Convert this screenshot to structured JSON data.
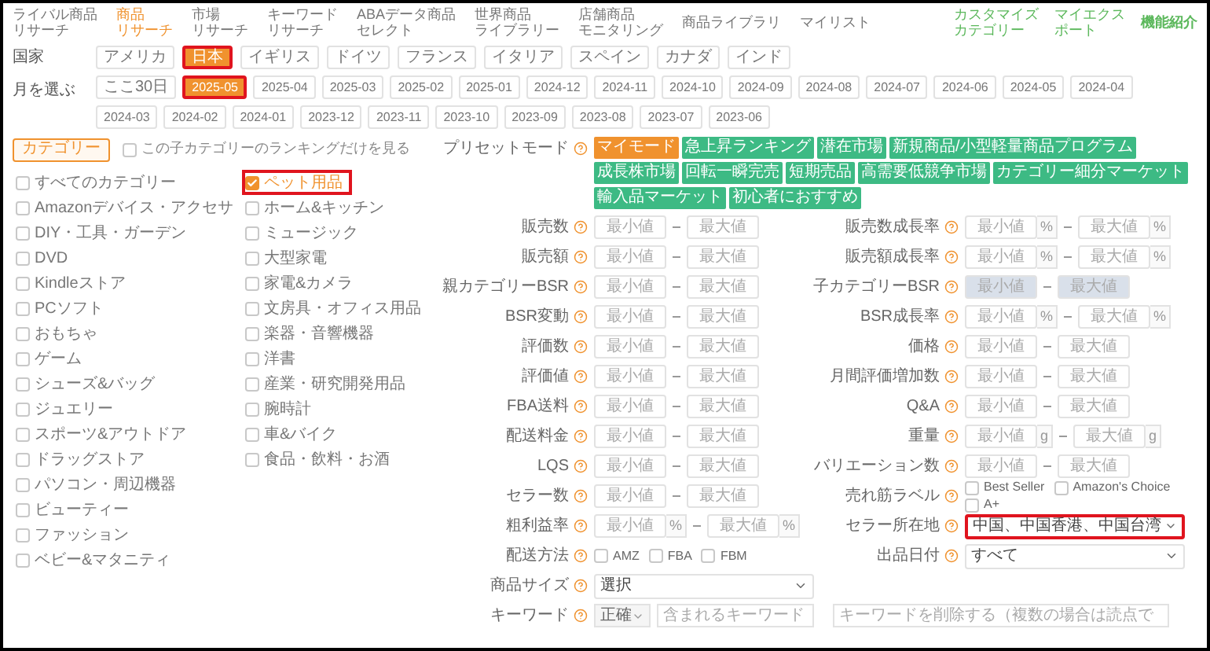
{
  "nav": {
    "items": [
      {
        "lines": [
          "ライバル商品",
          "リサーチ"
        ],
        "selected": false
      },
      {
        "lines": [
          "商品",
          "リサーチ"
        ],
        "selected": true
      },
      {
        "lines": [
          "市場",
          "リサーチ"
        ],
        "selected": false
      },
      {
        "lines": [
          "キーワード",
          "リサーチ"
        ],
        "selected": false
      },
      {
        "lines": [
          "ABAデータ商品",
          "セレクト"
        ],
        "selected": false
      },
      {
        "lines": [
          "世界商品",
          "ライブラリー"
        ],
        "selected": false
      },
      {
        "lines": [
          "店舗商品",
          "モニタリング"
        ],
        "selected": false
      },
      {
        "lines": [
          "商品ライブラリ"
        ],
        "selected": false
      },
      {
        "lines": [
          "マイリスト"
        ],
        "selected": false
      }
    ],
    "links": [
      {
        "lines": [
          "カスタマイズ",
          "カテゴリー"
        ],
        "kind": "link"
      },
      {
        "lines": [
          "マイエクス",
          "ポート"
        ],
        "kind": "link"
      },
      {
        "lines": [
          "機能紹介"
        ],
        "kind": "strong"
      }
    ]
  },
  "country": {
    "label": "国家",
    "options": [
      {
        "label": "アメリカ",
        "selected": false,
        "highlighted": false
      },
      {
        "label": "日本",
        "selected": true,
        "highlighted": true
      },
      {
        "label": "イギリス",
        "selected": false,
        "highlighted": false
      },
      {
        "label": "ドイツ",
        "selected": false,
        "highlighted": false
      },
      {
        "label": "フランス",
        "selected": false,
        "highlighted": false
      },
      {
        "label": "イタリア",
        "selected": false,
        "highlighted": false
      },
      {
        "label": "スペイン",
        "selected": false,
        "highlighted": false
      },
      {
        "label": "カナダ",
        "selected": false,
        "highlighted": false
      },
      {
        "label": "インド",
        "selected": false,
        "highlighted": false
      }
    ]
  },
  "month": {
    "label": "月を選ぶ",
    "options": [
      {
        "label": "ここ30日",
        "selected": false,
        "highlighted": false
      },
      {
        "label": "2025-05",
        "selected": true,
        "highlighted": true
      },
      {
        "label": "2025-04",
        "selected": false,
        "highlighted": false
      },
      {
        "label": "2025-03",
        "selected": false,
        "highlighted": false
      },
      {
        "label": "2025-02",
        "selected": false,
        "highlighted": false
      },
      {
        "label": "2025-01",
        "selected": false,
        "highlighted": false
      },
      {
        "label": "2024-12",
        "selected": false,
        "highlighted": false
      },
      {
        "label": "2024-11",
        "selected": false,
        "highlighted": false
      },
      {
        "label": "2024-10",
        "selected": false,
        "highlighted": false
      },
      {
        "label": "2024-09",
        "selected": false,
        "highlighted": false
      },
      {
        "label": "2024-08",
        "selected": false,
        "highlighted": false
      },
      {
        "label": "2024-07",
        "selected": false,
        "highlighted": false
      },
      {
        "label": "2024-06",
        "selected": false,
        "highlighted": false
      },
      {
        "label": "2024-05",
        "selected": false,
        "highlighted": false
      },
      {
        "label": "2024-04",
        "selected": false,
        "highlighted": false
      },
      {
        "label": "2024-03",
        "selected": false,
        "highlighted": false
      },
      {
        "label": "2024-02",
        "selected": false,
        "highlighted": false
      },
      {
        "label": "2024-01",
        "selected": false,
        "highlighted": false
      },
      {
        "label": "2023-12",
        "selected": false,
        "highlighted": false
      },
      {
        "label": "2023-11",
        "selected": false,
        "highlighted": false
      },
      {
        "label": "2023-10",
        "selected": false,
        "highlighted": false
      },
      {
        "label": "2023-09",
        "selected": false,
        "highlighted": false
      },
      {
        "label": "2023-08",
        "selected": false,
        "highlighted": false
      },
      {
        "label": "2023-07",
        "selected": false,
        "highlighted": false
      },
      {
        "label": "2023-06",
        "selected": false,
        "highlighted": false
      }
    ]
  },
  "category": {
    "button": "カテゴリー",
    "child_only": {
      "label": "この子カテゴリーのランキングだけを見る",
      "checked": false
    },
    "columns": [
      [
        {
          "label": "すべてのカテゴリー",
          "checked": false,
          "highlighted": false
        },
        {
          "label": "Amazonデバイス・アクセサ",
          "checked": false,
          "highlighted": false
        },
        {
          "label": "DIY・工具・ガーデン",
          "checked": false,
          "highlighted": false
        },
        {
          "label": "DVD",
          "checked": false,
          "highlighted": false
        },
        {
          "label": "Kindleストア",
          "checked": false,
          "highlighted": false
        },
        {
          "label": "PCソフト",
          "checked": false,
          "highlighted": false
        },
        {
          "label": "おもちゃ",
          "checked": false,
          "highlighted": false
        },
        {
          "label": "ゲーム",
          "checked": false,
          "highlighted": false
        },
        {
          "label": "シューズ&バッグ",
          "checked": false,
          "highlighted": false
        },
        {
          "label": "ジュエリー",
          "checked": false,
          "highlighted": false
        },
        {
          "label": "スポーツ&アウトドア",
          "checked": false,
          "highlighted": false
        },
        {
          "label": "ドラッグストア",
          "checked": false,
          "highlighted": false
        },
        {
          "label": "パソコン・周辺機器",
          "checked": false,
          "highlighted": false
        },
        {
          "label": "ビューティー",
          "checked": false,
          "highlighted": false
        },
        {
          "label": "ファッション",
          "checked": false,
          "highlighted": false
        },
        {
          "label": "ベビー&マタニティ",
          "checked": false,
          "highlighted": false
        }
      ],
      [
        {
          "label": "ペット用品",
          "checked": true,
          "highlighted": true
        },
        {
          "label": "ホーム&キッチン",
          "checked": false,
          "highlighted": false
        },
        {
          "label": "ミュージック",
          "checked": false,
          "highlighted": false
        },
        {
          "label": "大型家電",
          "checked": false,
          "highlighted": false
        },
        {
          "label": "家電&カメラ",
          "checked": false,
          "highlighted": false
        },
        {
          "label": "文房具・オフィス用品",
          "checked": false,
          "highlighted": false
        },
        {
          "label": "楽器・音響機器",
          "checked": false,
          "highlighted": false
        },
        {
          "label": "洋書",
          "checked": false,
          "highlighted": false
        },
        {
          "label": "産業・研究開発用品",
          "checked": false,
          "highlighted": false
        },
        {
          "label": "腕時計",
          "checked": false,
          "highlighted": false
        },
        {
          "label": "車&バイク",
          "checked": false,
          "highlighted": false
        },
        {
          "label": "食品・飲料・お酒",
          "checked": false,
          "highlighted": false
        }
      ]
    ]
  },
  "presets": {
    "label": "プリセットモード",
    "chips": [
      {
        "label": "マイモード",
        "selected": true
      },
      {
        "label": "急上昇ランキング",
        "selected": false
      },
      {
        "label": "潜在市場",
        "selected": false
      },
      {
        "label": "新規商品/小型軽量商品プログラム",
        "selected": false
      },
      {
        "label": "成長株市場",
        "selected": false
      },
      {
        "label": "回転一瞬完売",
        "selected": false
      },
      {
        "label": "短期売品",
        "selected": false
      },
      {
        "label": "高需要低競争市場",
        "selected": false
      },
      {
        "label": "カテゴリー細分マーケット",
        "selected": false
      },
      {
        "label": "輸入品マーケット",
        "selected": false
      },
      {
        "label": "初心者におすすめ",
        "selected": false
      }
    ]
  },
  "filter_rows": [
    [
      {
        "kind": "range",
        "label": "販売数",
        "min": {
          "placeholder": "最小値"
        },
        "max": {
          "placeholder": "最大値"
        },
        "disabled": false
      },
      {
        "kind": "range",
        "label": "販売数成長率",
        "min": {
          "placeholder": "最小値",
          "unit": "%"
        },
        "max": {
          "placeholder": "最大値",
          "unit": "%"
        },
        "disabled": false
      }
    ],
    [
      {
        "kind": "range",
        "label": "販売額",
        "min": {
          "placeholder": "最小値"
        },
        "max": {
          "placeholder": "最大値"
        },
        "disabled": false
      },
      {
        "kind": "range",
        "label": "販売額成長率",
        "min": {
          "placeholder": "最小値",
          "unit": "%"
        },
        "max": {
          "placeholder": "最大値",
          "unit": "%"
        },
        "disabled": false
      }
    ],
    [
      {
        "kind": "range",
        "label": "親カテゴリーBSR",
        "min": {
          "placeholder": "最小値"
        },
        "max": {
          "placeholder": "最大値"
        },
        "disabled": false
      },
      {
        "kind": "range",
        "label": "子カテゴリーBSR",
        "min": {
          "placeholder": "最小値"
        },
        "max": {
          "placeholder": "最大値"
        },
        "disabled": true
      }
    ],
    [
      {
        "kind": "range",
        "label": "BSR変動",
        "min": {
          "placeholder": "最小値"
        },
        "max": {
          "placeholder": "最大値"
        },
        "disabled": false
      },
      {
        "kind": "range",
        "label": "BSR成長率",
        "min": {
          "placeholder": "最小値",
          "unit": "%"
        },
        "max": {
          "placeholder": "最大値",
          "unit": "%"
        },
        "disabled": false
      }
    ],
    [
      {
        "kind": "range",
        "label": "評価数",
        "min": {
          "placeholder": "最小値"
        },
        "max": {
          "placeholder": "最大値"
        },
        "disabled": false
      },
      {
        "kind": "range",
        "label": "価格",
        "min": {
          "placeholder": "最小値"
        },
        "max": {
          "placeholder": "最大値"
        },
        "disabled": false
      }
    ],
    [
      {
        "kind": "range",
        "label": "評価値",
        "min": {
          "placeholder": "最小値"
        },
        "max": {
          "placeholder": "最大値"
        },
        "disabled": false
      },
      {
        "kind": "range",
        "label": "月間評価増加数",
        "min": {
          "placeholder": "最小値"
        },
        "max": {
          "placeholder": "最大値"
        },
        "disabled": false
      }
    ],
    [
      {
        "kind": "range",
        "label": "FBA送料",
        "min": {
          "placeholder": "最小値"
        },
        "max": {
          "placeholder": "最大値"
        },
        "disabled": false
      },
      {
        "kind": "range",
        "label": "Q&A",
        "min": {
          "placeholder": "最小値"
        },
        "max": {
          "placeholder": "最大値"
        },
        "disabled": false
      }
    ],
    [
      {
        "kind": "range",
        "label": "配送料金",
        "min": {
          "placeholder": "最小値"
        },
        "max": {
          "placeholder": "最大値"
        },
        "disabled": false
      },
      {
        "kind": "range",
        "label": "重量",
        "min": {
          "placeholder": "最小値",
          "unit": "g"
        },
        "max": {
          "placeholder": "最大値",
          "unit": "g"
        },
        "disabled": false
      }
    ],
    [
      {
        "kind": "range",
        "label": "LQS",
        "min": {
          "placeholder": "最小値"
        },
        "max": {
          "placeholder": "最大値"
        },
        "disabled": false
      },
      {
        "kind": "range",
        "label": "バリエーション数",
        "min": {
          "placeholder": "最小値"
        },
        "max": {
          "placeholder": "最大値"
        },
        "disabled": false
      }
    ],
    [
      {
        "kind": "range",
        "label": "セラー数",
        "min": {
          "placeholder": "最小値"
        },
        "max": {
          "placeholder": "最大値"
        },
        "disabled": false
      },
      {
        "kind": "checks",
        "label": "売れ筋ラベル",
        "options": [
          {
            "label": "Best Seller",
            "checked": false
          },
          {
            "label": "Amazon's Choice",
            "checked": false
          },
          {
            "label": "A+",
            "checked": false
          }
        ]
      }
    ],
    [
      {
        "kind": "range",
        "label": "粗利益率",
        "min": {
          "placeholder": "最小値",
          "unit": "%"
        },
        "max": {
          "placeholder": "最大値",
          "unit": "%"
        },
        "disabled": false
      },
      {
        "kind": "select",
        "label": "セラー所在地",
        "value": "中国、中国香港、中国台湾",
        "highlighted": true
      }
    ],
    [
      {
        "kind": "checks",
        "label": "配送方法",
        "options": [
          {
            "label": "AMZ",
            "checked": false
          },
          {
            "label": "FBA",
            "checked": false
          },
          {
            "label": "FBM",
            "checked": false
          }
        ]
      },
      {
        "kind": "select",
        "label": "出品日付",
        "value": "すべて",
        "highlighted": false
      }
    ],
    [
      {
        "kind": "select",
        "label": "商品サイズ",
        "value": "選択",
        "highlighted": false
      }
    ],
    [
      {
        "kind": "keyword",
        "label": "キーワード",
        "mode": "正確",
        "placeholder": "含まれるキーワード",
        "exclude_placeholder": "キーワードを削除する（複数の場合は読点で"
      }
    ]
  ]
}
